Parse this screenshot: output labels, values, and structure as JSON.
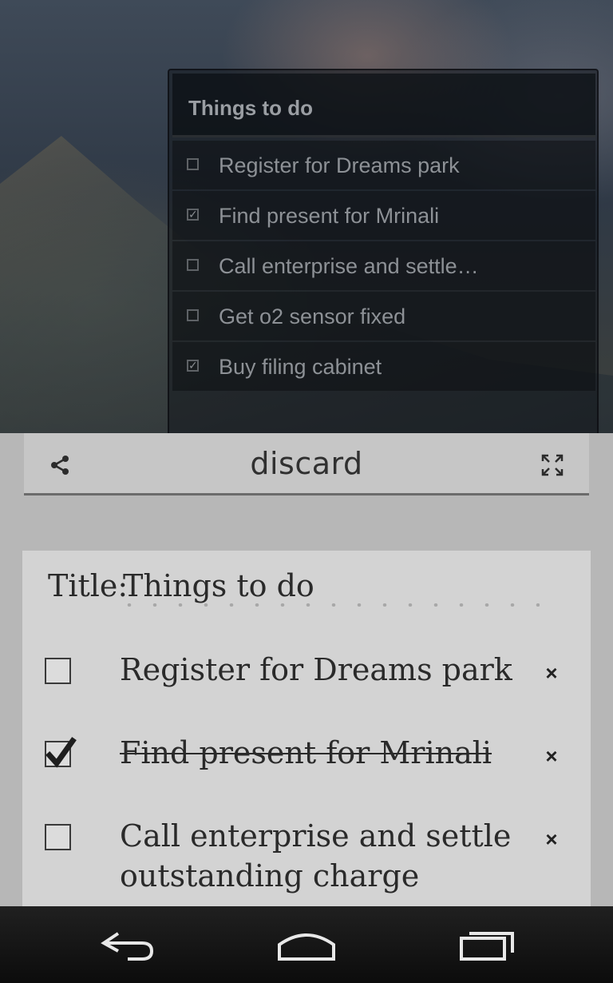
{
  "widget": {
    "title": "Things to do",
    "items": [
      {
        "label": "Register for Dreams park",
        "checked": false
      },
      {
        "label": "Find present for Mrinali",
        "checked": true
      },
      {
        "label": "Call enterprise and settle…",
        "checked": false
      },
      {
        "label": "Get o2 sensor fixed",
        "checked": false
      },
      {
        "label": "Buy filing cabinet",
        "checked": true
      }
    ]
  },
  "editor": {
    "toolbar": {
      "share_icon": "share-icon",
      "discard_label": "discard",
      "expand_icon": "expand-icon"
    },
    "title_label": "Title:",
    "title_value": "Things to do",
    "todos": [
      {
        "label": "Register for Dreams park",
        "checked": false,
        "remove": "×"
      },
      {
        "label": "Find present for Mrinali",
        "checked": true,
        "remove": "×"
      },
      {
        "label": "Call enterprise and settle outstanding charge",
        "checked": false,
        "remove": "×"
      }
    ]
  },
  "navbar": {
    "back_icon": "back-icon",
    "home_icon": "home-icon",
    "recents_icon": "recents-icon"
  }
}
